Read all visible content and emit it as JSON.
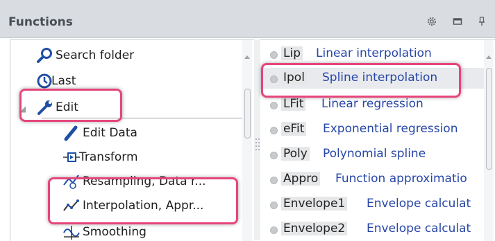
{
  "panel": {
    "title": "Functions",
    "header_icons": [
      "gear-icon",
      "maximize-icon",
      "pin-icon"
    ]
  },
  "tree": {
    "items": [
      {
        "label": "Search folder",
        "icon": "search-icon"
      },
      {
        "label": "Last",
        "icon": "clock-icon"
      },
      {
        "label": "Edit",
        "icon": "wrench-icon",
        "expanded": true,
        "highlighted": true
      },
      {
        "label": "Edit Data",
        "icon": "pencil-icon"
      },
      {
        "label": "Transform",
        "icon": "transform-icon"
      },
      {
        "label": "Resampling, Data r...",
        "icon": "resampling-icon"
      },
      {
        "label": "Interpolation, Appr...",
        "icon": "interpolation-icon",
        "highlighted": true
      },
      {
        "label": "Smoothing",
        "icon": "smoothing-icon"
      }
    ]
  },
  "functions": {
    "items": [
      {
        "abbr": "Lip",
        "desc": "Linear interpolation"
      },
      {
        "abbr": "Ipol",
        "desc": "Spline interpolation",
        "selected": true,
        "highlighted": true
      },
      {
        "abbr": "LFit",
        "desc": "Linear regression"
      },
      {
        "abbr": "eFit",
        "desc": "Exponential regression"
      },
      {
        "abbr": "Poly",
        "desc": "Polynomial spline"
      },
      {
        "abbr": "Appro",
        "desc": "Function approximatio"
      },
      {
        "abbr": "Envelope1",
        "desc": "Envelope calculat"
      },
      {
        "abbr": "Envelope2",
        "desc": "Envelope calculat"
      }
    ]
  },
  "colors": {
    "header_bg": "#d9dde2",
    "link_blue": "#2746a8",
    "highlight": "#e6457a",
    "selected_bg": "#e8eaed"
  }
}
